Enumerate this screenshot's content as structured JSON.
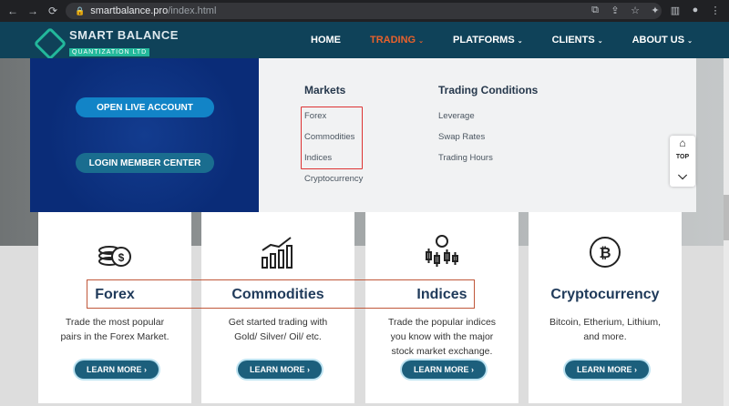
{
  "browser": {
    "url_host": "smartbalance.pro",
    "url_path": "/index.html"
  },
  "site": {
    "logo_line1": "SMART BALANCE",
    "logo_line2": "QUANTIZATION LTD",
    "nav": [
      {
        "label": "HOME"
      },
      {
        "label": "TRADING"
      },
      {
        "label": "PLATFORMS"
      },
      {
        "label": "CLIENTS"
      },
      {
        "label": "ABOUT US"
      }
    ]
  },
  "panel": {
    "open_live": "OPEN LIVE ACCOUNT",
    "login_member": "LOGIN MEMBER CENTER"
  },
  "mega": {
    "markets_title": "Markets",
    "markets": [
      "Forex",
      "Commodities",
      "Indices",
      "Cryptocurrency"
    ],
    "trading_title": "Trading Conditions",
    "trading": [
      "Leverage",
      "Swap Rates",
      "Trading Hours"
    ]
  },
  "top_label": "TOP",
  "cards": [
    {
      "title": "Forex",
      "line1": "Trade the most popular",
      "line2": "pairs in the Forex Market.",
      "line3": "",
      "button": "LEARN MORE"
    },
    {
      "title": "Commodities",
      "line1": "Get started trading with",
      "line2": "Gold/ Silver/ Oil/ etc.",
      "line3": "",
      "button": "LEARN MORE"
    },
    {
      "title": "Indices",
      "line1": "Trade the popular indices",
      "line2": "you know with the major",
      "line3": "stock market exchange.",
      "button": "LEARN MORE"
    },
    {
      "title": "Cryptocurrency",
      "line1": "Bitcoin, Etherium, Lithium,",
      "line2": "and more.",
      "line3": "",
      "button": "LEARN MORE"
    }
  ],
  "colors": {
    "header": "#0f4259",
    "accent": "#e8612c",
    "brand": "#23b89b"
  }
}
